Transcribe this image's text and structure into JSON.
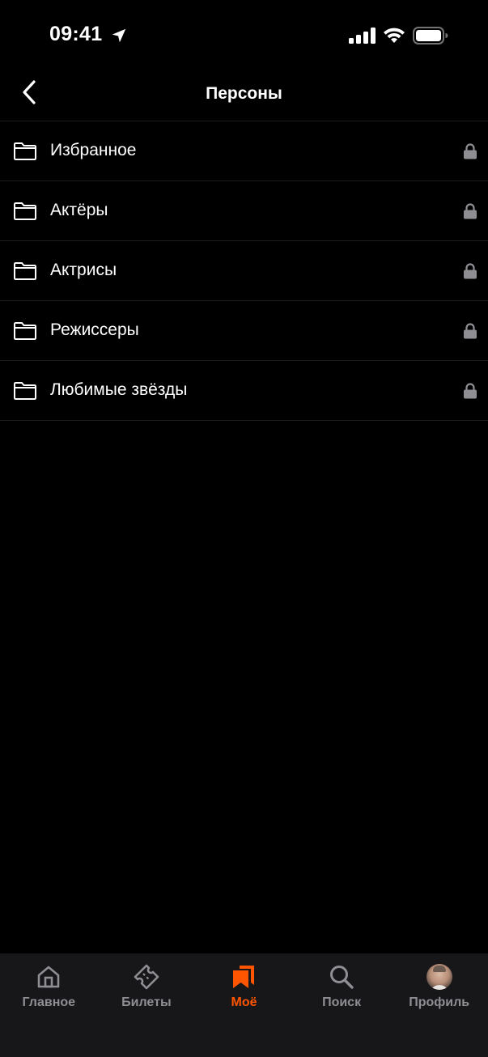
{
  "status_bar": {
    "time": "09:41",
    "icons": [
      "location-arrow-icon",
      "cellular-signal-icon",
      "wifi-icon",
      "battery-icon"
    ]
  },
  "nav": {
    "title": "Персоны",
    "back_icon": "chevron-left-icon"
  },
  "folders": [
    {
      "label": "Избранное",
      "icon": "folder-icon",
      "locked": true
    },
    {
      "label": "Актёры",
      "icon": "folder-icon",
      "locked": true
    },
    {
      "label": "Актрисы",
      "icon": "folder-icon",
      "locked": true
    },
    {
      "label": "Режиссеры",
      "icon": "folder-icon",
      "locked": true
    },
    {
      "label": "Любимые звёзды",
      "icon": "folder-icon",
      "locked": true
    }
  ],
  "tab_bar": {
    "active": "Моё",
    "tabs": [
      {
        "label": "Главное",
        "icon": "home-icon"
      },
      {
        "label": "Билеты",
        "icon": "ticket-icon"
      },
      {
        "label": "Моё",
        "icon": "bookmarks-icon"
      },
      {
        "label": "Поиск",
        "icon": "search-icon"
      },
      {
        "label": "Профиль",
        "icon": "avatar"
      }
    ]
  },
  "colors": {
    "background": "#000000",
    "tab_bar_background": "#171719",
    "accent": "#ff5500",
    "inactive": "#8e8e93",
    "lock": "#8e8e93",
    "separator": "#1c1c1e"
  }
}
